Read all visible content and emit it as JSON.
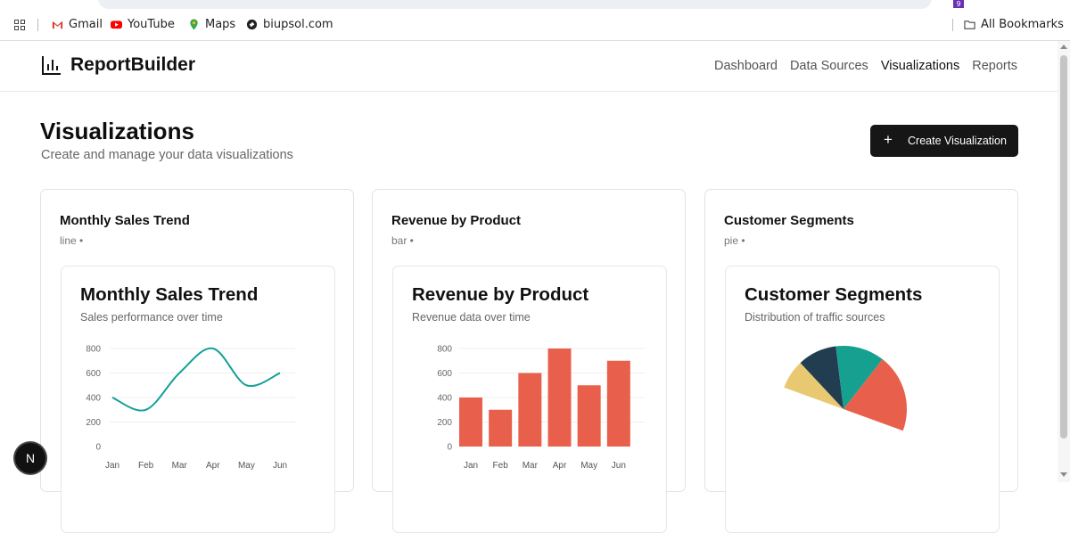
{
  "bookmarks_bar": {
    "items": [
      {
        "label": "Gmail",
        "icon": "gmail-icon"
      },
      {
        "label": "YouTube",
        "icon": "youtube-icon"
      },
      {
        "label": "Maps",
        "icon": "maps-pin-icon"
      },
      {
        "label": "biupsol.com",
        "icon": "globe-icon"
      }
    ],
    "all_bookmarks": "All Bookmarks",
    "extension_badge": "9"
  },
  "app": {
    "brand": "ReportBuilder",
    "brand_icon": "bar-chart-icon",
    "nav": [
      {
        "label": "Dashboard",
        "active": false
      },
      {
        "label": "Data Sources",
        "active": false
      },
      {
        "label": "Visualizations",
        "active": true
      },
      {
        "label": "Reports",
        "active": false
      }
    ]
  },
  "page": {
    "title": "Visualizations",
    "subtitle": "Create and manage your data visualizations",
    "create_button": "Create Visualization",
    "create_icon": "+"
  },
  "cards": [
    {
      "title": "Monthly Sales Trend",
      "meta": "line •",
      "inner_title": "Monthly Sales Trend",
      "inner_subtitle": "Sales performance over time"
    },
    {
      "title": "Revenue by Product",
      "meta": "bar •",
      "inner_title": "Revenue by Product",
      "inner_subtitle": "Revenue data over time"
    },
    {
      "title": "Customer Segments",
      "meta": "pie •",
      "inner_title": "Customer Segments",
      "inner_subtitle": "Distribution of traffic sources"
    }
  ],
  "chart_data": [
    {
      "type": "line",
      "categories": [
        "Jan",
        "Feb",
        "Mar",
        "Apr",
        "May",
        "Jun"
      ],
      "values": [
        400,
        300,
        600,
        800,
        500,
        600
      ],
      "ylim": [
        0,
        800
      ],
      "yticks": [
        "800",
        "600",
        "400",
        "200",
        "0"
      ],
      "color": "#14a098"
    },
    {
      "type": "bar",
      "categories": [
        "Jan",
        "Feb",
        "Mar",
        "Apr",
        "May",
        "Jun"
      ],
      "values": [
        400,
        300,
        600,
        800,
        500,
        700
      ],
      "ylim": [
        0,
        800
      ],
      "yticks": [
        "800",
        "600",
        "400",
        "200",
        "0"
      ],
      "color": "#e8604c"
    },
    {
      "type": "pie",
      "slices": [
        {
          "value": 15,
          "color": "#e8c870"
        },
        {
          "value": 20,
          "color": "#213d4f"
        },
        {
          "value": 25,
          "color": "#15a090"
        },
        {
          "value": 40,
          "color": "#e8604c"
        }
      ]
    }
  ],
  "floating_badge": "N"
}
